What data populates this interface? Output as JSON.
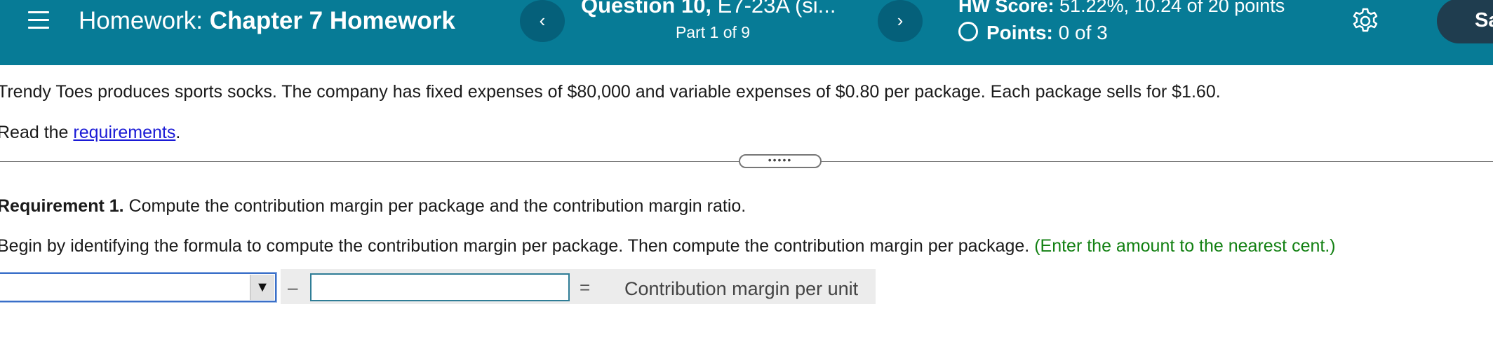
{
  "header": {
    "homework_prefix": "Homework:",
    "homework_name": "Chapter 7 Homework",
    "prev_label": "‹",
    "next_label": "›",
    "question_label": "Question 10,",
    "question_id": " E7-23A (si...",
    "part_text": "Part 1 of 9",
    "hw_score_label": "HW Score:",
    "hw_score_value": " 51.22%, 10.24 of 20 points",
    "points_label": "Points:",
    "points_value": " 0 of 3",
    "settings_icon": "gear-icon",
    "save_label": "Sa"
  },
  "problem": {
    "intro": "Trendy Toes produces sports socks. The company has fixed expenses of $80,000 and variable expenses of $0.80 per package. Each package sells for $1.60.",
    "read_prefix": "Read the ",
    "read_link": "requirements",
    "read_suffix": "."
  },
  "splitter": {
    "dots": "•••••"
  },
  "requirement": {
    "label": "Requirement 1.",
    "text": " Compute the contribution margin per package and the contribution margin ratio.",
    "instruction": "Begin by identifying the formula to compute the contribution margin per package. Then compute the contribution margin per package.",
    "hint": " (Enter the amount to the nearest cent.)"
  },
  "formula": {
    "dropdown_value": "",
    "dropdown_arrow": "▼",
    "minus": "–",
    "input_value": "",
    "equals": "=",
    "result_label": "Contribution margin per unit"
  },
  "colors": {
    "header_bg": "#077b96",
    "nav_button_bg": "#05607a",
    "save_button_bg": "#1f3d4f",
    "link": "#1a1ad6",
    "hint": "#128012"
  }
}
